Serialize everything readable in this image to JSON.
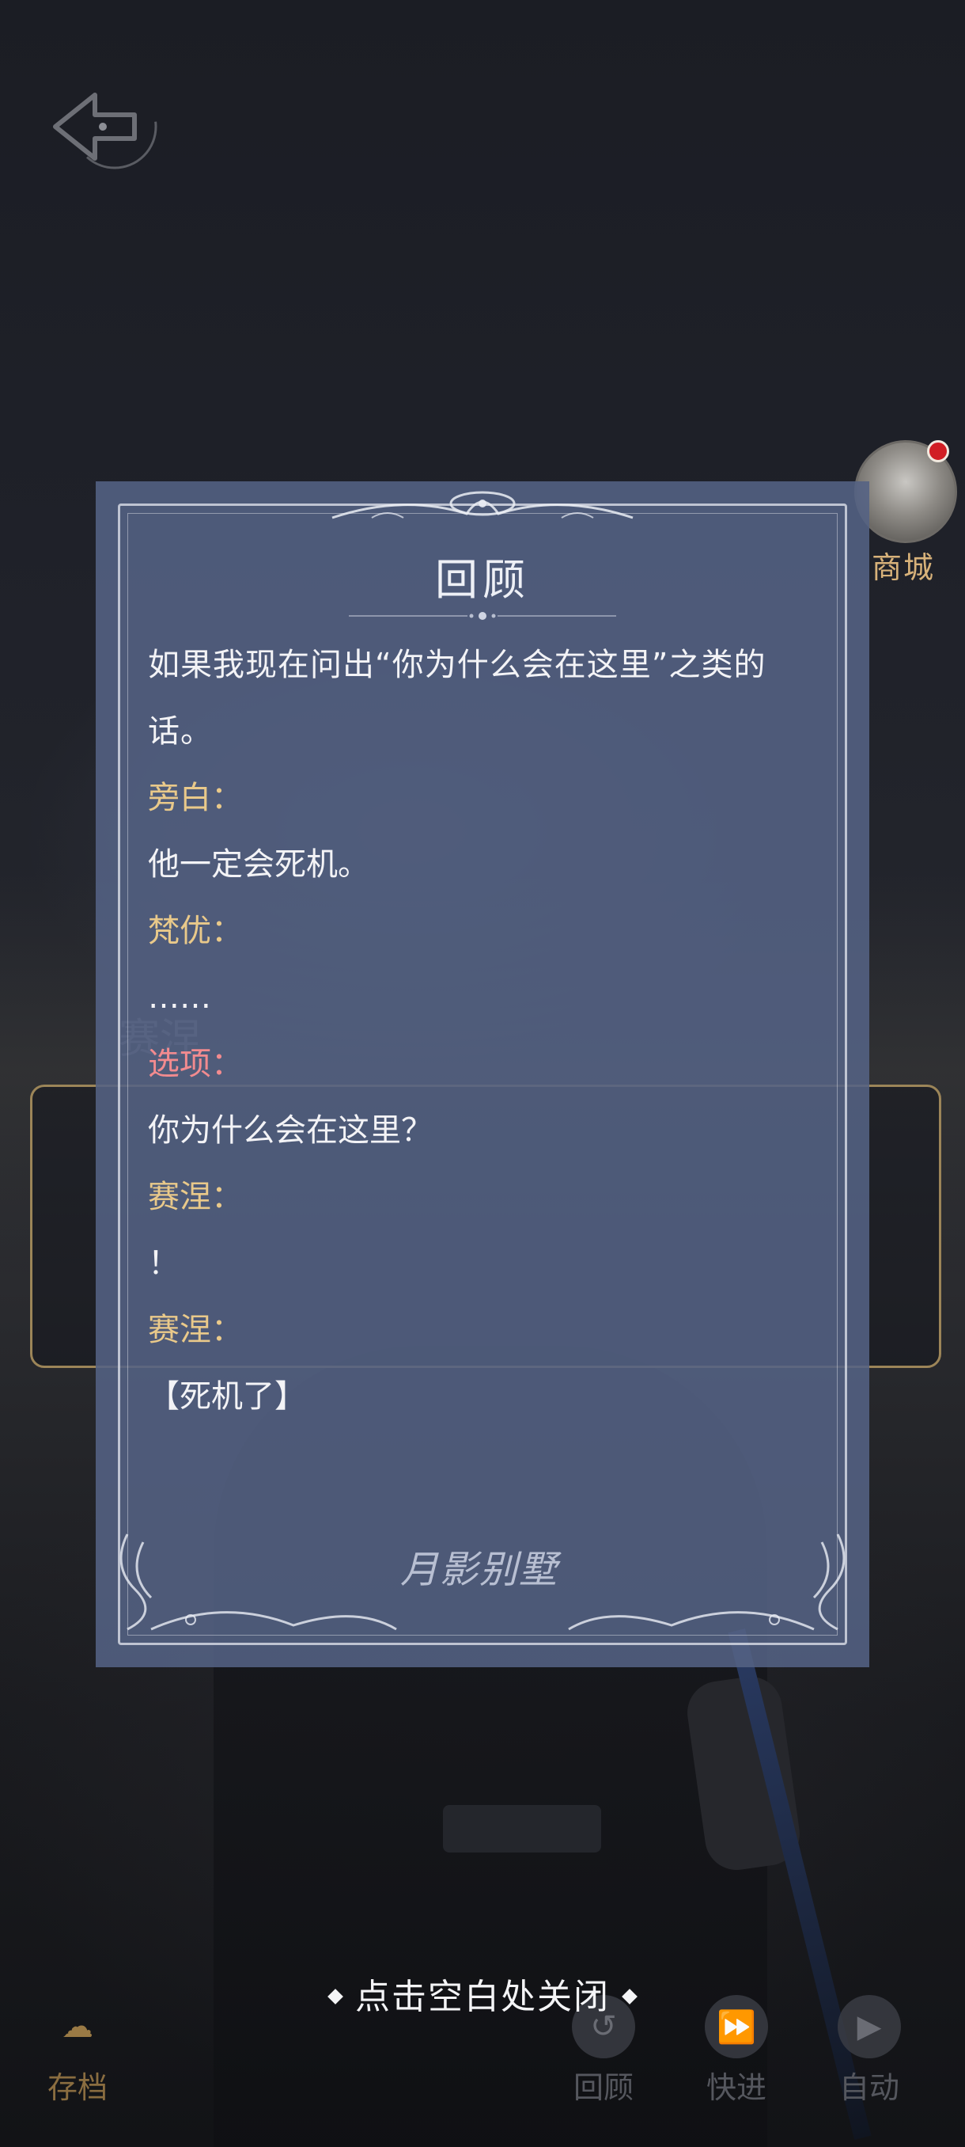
{
  "backlog": {
    "title": "回顾",
    "logo_text": "月影别墅",
    "entries": [
      {
        "type": "text",
        "text": "如果我现在问出“你为什么会在这里”之类的话。"
      },
      {
        "type": "speaker",
        "text": "旁白："
      },
      {
        "type": "text",
        "text": "他一定会死机。"
      },
      {
        "type": "speaker",
        "text": "梵优："
      },
      {
        "type": "text",
        "text": "……"
      },
      {
        "type": "choice_label",
        "text": "选项："
      },
      {
        "type": "text",
        "text": " 你为什么会在这里？"
      },
      {
        "type": "speaker",
        "text": "赛涅："
      },
      {
        "type": "text",
        "text": "！"
      },
      {
        "type": "speaker",
        "text": "赛涅："
      },
      {
        "type": "text",
        "text": "【死机了】"
      }
    ],
    "close_hint": "点击空白处关闭"
  },
  "background": {
    "speaker_ghost": "赛涅",
    "shop_label": "商城"
  },
  "bottom_bar": {
    "save": {
      "label": "存档",
      "icon": "save-cloud-icon"
    },
    "review": {
      "label": "回顾",
      "icon": "review-icon"
    },
    "fast_forward": {
      "label": "快进",
      "icon": "fast-forward-icon"
    },
    "auto": {
      "label": "自动",
      "icon": "play-icon"
    }
  },
  "colors": {
    "panel_bg": "#54627f",
    "speaker": "#e9c98a",
    "choice": "#f28b8f",
    "gold_label": "#d8b27a"
  }
}
